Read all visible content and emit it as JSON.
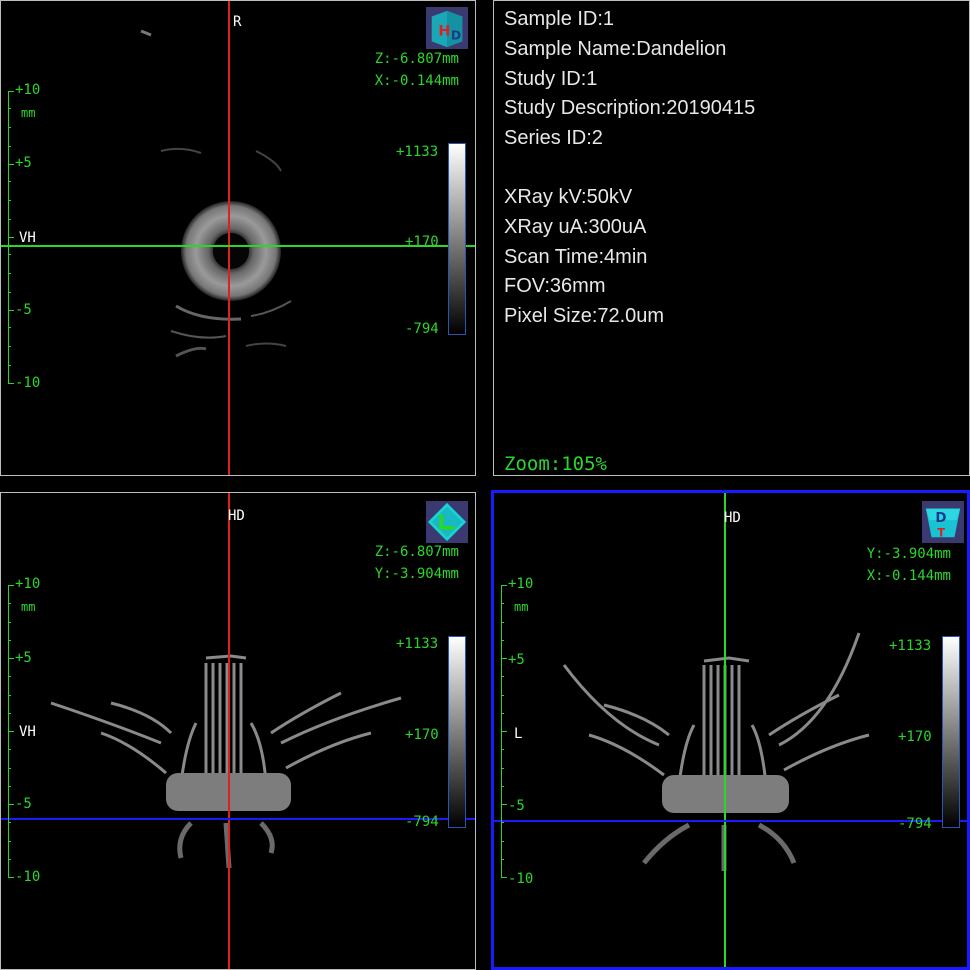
{
  "views": {
    "top_left": {
      "orientation_top": "R",
      "orientation_left": "VH",
      "coord1": "Z:-6.807mm",
      "coord2": "X:-0.144mm",
      "colorbar": {
        "max": "+1133",
        "mid": "+170",
        "min": "-794"
      },
      "ruler": {
        "p10": "+10",
        "unit": "mm",
        "p5": "+5",
        "m5": "-5",
        "m10": "-10"
      },
      "cube_icon": "cube-HD-icon"
    },
    "bottom_left": {
      "orientation_top": "HD",
      "orientation_left": "VH",
      "coord1": "Z:-6.807mm",
      "coord2": "Y:-3.904mm",
      "colorbar": {
        "max": "+1133",
        "mid": "+170",
        "min": "-794"
      },
      "ruler": {
        "p10": "+10",
        "unit": "mm",
        "p5": "+5",
        "m5": "-5",
        "m10": "-10"
      },
      "cube_icon": "cube-L-icon"
    },
    "bottom_right": {
      "orientation_top": "HD",
      "orientation_left": "L",
      "coord1": "Y:-3.904mm",
      "coord2": "X:-0.144mm",
      "colorbar": {
        "max": "+1133",
        "mid": "+170",
        "min": "-794"
      },
      "ruler": {
        "p10": "+10",
        "unit": "mm",
        "p5": "+5",
        "m5": "-5",
        "m10": "-10"
      },
      "cube_icon": "cube-DT-icon"
    }
  },
  "info": {
    "sample_id": "Sample ID:1",
    "sample_name": "Sample Name:Dandelion",
    "study_id": "Study ID:1",
    "study_description": "Study Description:20190415",
    "series_id": "Series ID:2",
    "xray_kv": "XRay kV:50kV",
    "xray_ua": "XRay uA:300uA",
    "scan_time": "Scan Time:4min",
    "fov": "FOV:36mm",
    "pixel_size": "Pixel Size:72.0um",
    "zoom": "Zoom:105%"
  },
  "colors": {
    "crosshair_red": "#e0201c",
    "crosshair_green": "#2bd62b",
    "crosshair_blue": "#1a1aff",
    "overlay_green": "#2bd62b",
    "active_border": "#1a1aff"
  }
}
